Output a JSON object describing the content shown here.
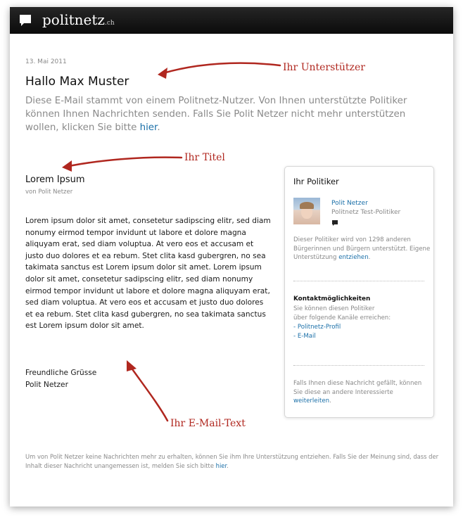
{
  "header": {
    "brand": "politnetz",
    "brand_tld": ".ch"
  },
  "email": {
    "date": "13. Mai 2011",
    "greeting": "Hallo Max Muster",
    "intro_text": "Diese E-Mail stammt von einem Politnetz-Nutzer. Von Ihnen unterstützte Politiker können Ihnen Nachrichten senden. Falls Sie Polit Netzer nicht mehr unterstützen wollen, klicken Sie bitte ",
    "intro_link": "hier",
    "intro_end": ".",
    "title": "Lorem Ipsum",
    "author": "von Polit Netzer",
    "body": "Lorem ipsum dolor sit amet, consetetur sadipscing elitr, sed diam nonumy eirmod tempor invidunt ut labore et dolore magna aliquyam erat, sed diam voluptua. At vero eos et accusam et justo duo dolores et ea rebum. Stet clita kasd gubergren, no sea takimata sanctus est Lorem ipsum dolor sit amet. Lorem ipsum dolor sit amet, consetetur sadipscing elitr, sed diam nonumy eirmod tempor invidunt ut labore et dolore magna aliquyam erat, sed diam voluptua. At vero eos et accusam et justo duo dolores et ea rebum. Stet clita kasd gubergren, no sea takimata sanctus est Lorem ipsum dolor sit amet.",
    "closing_1": "Freundliche Grüsse",
    "closing_2": "Polit Netzer"
  },
  "annotations": {
    "supporter": "Ihr Unterstützer",
    "title": "Ihr Titel",
    "email_text": "Ihr E-Mail-Text"
  },
  "politician_card": {
    "heading": "Ihr Politiker",
    "name": "Polit Netzer",
    "role": "Politnetz Test-Politiker",
    "support_text": "Dieser Politiker wird von 1298 anderen Bürgerinnen und Bürgern unterstützt. Eigene Unterstützung ",
    "support_link": "entziehen",
    "support_end": ".",
    "contact_heading": "Kontaktmöglichkeiten",
    "contact_text_1": "Sie können diesen Politiker",
    "contact_text_2": "über folgende Kanäle erreichen:",
    "link_profile": "- Politnetz-Profil",
    "link_email": "- E-Mail",
    "forward_text": "Falls Ihnen diese Nachricht gefällt, können Sie diese an andere Interessierte ",
    "forward_link": "weiterleiten",
    "forward_end": "."
  },
  "footer": {
    "text": "Um von Polit Netzer keine Nachrichten mehr zu erhalten, können Sie ihm Ihre Unterstützung entziehen. Falls Sie der Meinung sind, dass der Inhalt dieser Nachricht unangemessen ist, melden Sie sich bitte ",
    "link": "hier",
    "end": "."
  },
  "colors": {
    "accent_link": "#1a6fa8",
    "annotation": "#b0271f",
    "topbar": "#111111"
  },
  "icons": {
    "logo": "speech-bubble-icon",
    "politician_mark": "speech-bubble-icon"
  }
}
